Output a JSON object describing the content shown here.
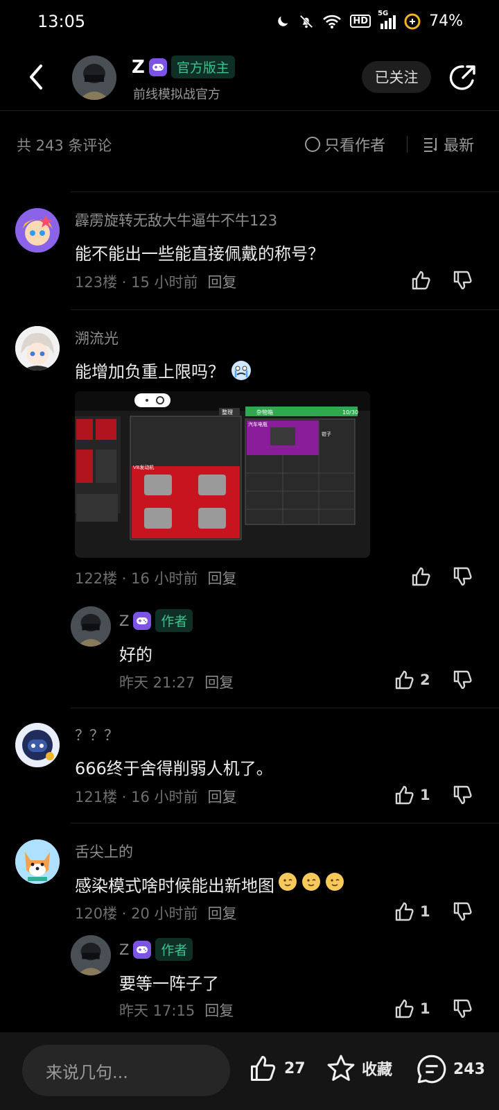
{
  "status": {
    "time": "13:05",
    "hd": "HD",
    "net": "5G",
    "battery": "74%"
  },
  "header": {
    "name": "Z",
    "badge": "官方版主",
    "subtitle": "前线模拟战官方",
    "follow_label": "已关注"
  },
  "filter": {
    "count": "共 243 条评论",
    "only_author": "只看作者",
    "sort": "最新"
  },
  "comments": [
    {
      "user": "霹雳旋转无敌大牛逼牛不牛123",
      "text": "能不能出一些能直接佩戴的称号？",
      "floor": "123楼 · 15 小时前",
      "reply_label": "回复",
      "likes": ""
    },
    {
      "user": "溯流光",
      "text": "能增加负重上限吗？",
      "floor": "122楼 · 16 小时前",
      "reply_label": "回复",
      "likes": "",
      "image": {
        "top_left_label": "整理",
        "panel_title": "杂物箱",
        "panel_count": "10/30",
        "item_a": "V8发动机",
        "item_b": "汽车电瓶",
        "item_c": "钳子"
      },
      "author_reply": {
        "name": "Z",
        "badge": "作者",
        "text": "好的",
        "time": "昨天 21:27",
        "reply_label": "回复",
        "likes": "2"
      }
    },
    {
      "user": "？？？",
      "text": "666终于舍得削弱人机了。",
      "floor": "121楼 · 16 小时前",
      "reply_label": "回复",
      "likes": "1"
    },
    {
      "user": "舌尖上的",
      "text": "感染模式啥时候能出新地图",
      "floor": "120楼 · 20 小时前",
      "reply_label": "回复",
      "likes": "1",
      "author_reply": {
        "name": "Z",
        "badge": "作者",
        "text": "要等一阵子了",
        "time": "昨天 17:15",
        "reply_label": "回复",
        "likes": "1"
      }
    }
  ],
  "bottom": {
    "input_placeholder": "来说几句...",
    "likes": "27",
    "favorite_label": "收藏",
    "comments": "243"
  },
  "colors": {
    "background": "#000000",
    "badge_green": "#3ec28f",
    "game_purple": "#7b54e6"
  }
}
